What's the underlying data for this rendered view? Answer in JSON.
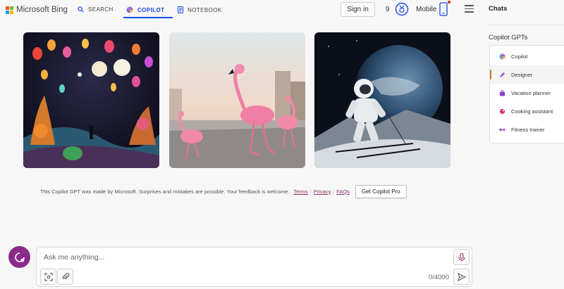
{
  "header": {
    "brand": "Microsoft Bing",
    "nav": {
      "search": "SEARCH",
      "copilot": "COPILOT",
      "notebook": "NOTEBOOK"
    },
    "sign_in": "Sign in",
    "points": "9",
    "mobile": "Mobile"
  },
  "gallery": {
    "images": [
      {
        "subject": "lantern-night-garden"
      },
      {
        "subject": "flamingos-running"
      },
      {
        "subject": "astronaut-skiing"
      }
    ]
  },
  "disclaimer": {
    "text": "This Copilot GPT was made by Microsoft. Surprises and mistakes are possible. Your feedback is welcome.",
    "terms": "Terms",
    "privacy": "Privacy",
    "faqs": "FAQs",
    "pro_button": "Get Copilot Pro"
  },
  "composer": {
    "placeholder": "Ask me anything...",
    "char_count": "0/4000"
  },
  "sidebar": {
    "chats_title": "Chats",
    "gpts_title": "Copilot GPTs",
    "items": [
      {
        "label": "Copilot",
        "icon": "copilot-icon",
        "color": "#5b8def"
      },
      {
        "label": "Designer",
        "icon": "designer-icon",
        "color": "#9b4fd1",
        "active": true
      },
      {
        "label": "Vacation planner",
        "icon": "suitcase-icon",
        "color": "#8a3fd0"
      },
      {
        "label": "Cooking assistant",
        "icon": "cooking-icon",
        "color": "#d6337a"
      },
      {
        "label": "Fitness trainer",
        "icon": "dumbbell-icon",
        "color": "#9a3fc0"
      }
    ]
  },
  "colors": {
    "accent": "#174ae4",
    "avatar": "#8c2a8c",
    "active_bar": "#c27a26",
    "link": "#8a2f6a"
  }
}
